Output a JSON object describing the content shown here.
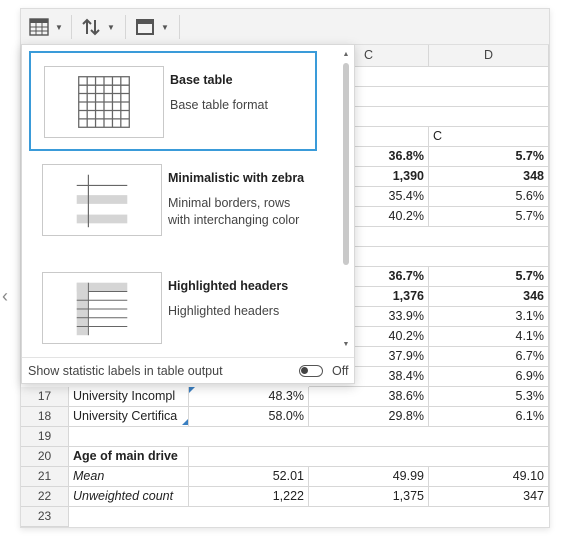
{
  "toolbar": {
    "table_icon": "table-format-icon",
    "sort_icon": "sort-updown-icon",
    "layout_icon": "panel-layout-icon"
  },
  "grid": {
    "col_headers": [
      "C",
      "D"
    ],
    "row1": {
      "num": "",
      "c_sub": "C"
    },
    "rows_upper": [
      {
        "c": "36.8%",
        "d": "5.7%",
        "bold": true
      },
      {
        "c": "1,390",
        "d": "348",
        "bold": true
      },
      {
        "c": "35.4%",
        "d": "5.6%",
        "bold": false
      },
      {
        "c": "40.2%",
        "d": "5.7%",
        "bold": false
      }
    ],
    "rows_mid": [
      {
        "c": "36.7%",
        "d": "5.7%",
        "bold": true
      },
      {
        "c": "1,376",
        "d": "346",
        "bold": true
      },
      {
        "c": "33.9%",
        "d": "3.1%",
        "bold": false
      },
      {
        "c": "40.2%",
        "d": "4.1%",
        "bold": false
      },
      {
        "c": "37.9%",
        "d": "6.7%",
        "bold": false
      },
      {
        "c": "38.4%",
        "d": "6.9%",
        "bold": false
      }
    ],
    "rows_lower": [
      {
        "num": "17",
        "a": "University Incompl",
        "b": "48.3%",
        "c": "38.6%",
        "d": "5.3%"
      },
      {
        "num": "18",
        "a": "University Certifica",
        "b": "58.0%",
        "c": "29.8%",
        "d": "6.1%"
      },
      {
        "num": "19",
        "a": "",
        "b": "",
        "c": "",
        "d": ""
      },
      {
        "num": "20",
        "a": "Age of main drive",
        "b": "",
        "c": "",
        "d": ""
      },
      {
        "num": "21",
        "a": "Mean",
        "b": "52.01",
        "c": "49.99",
        "d": "49.10"
      },
      {
        "num": "22",
        "a": "Unweighted count",
        "b": "1,222",
        "c": "1,375",
        "d": "347"
      },
      {
        "num": "23",
        "a": "",
        "b": "",
        "c": "",
        "d": ""
      }
    ]
  },
  "popup": {
    "options": [
      {
        "title": "Base table",
        "desc": "Base table format"
      },
      {
        "title": "Minimalistic with zebra",
        "desc": "Minimal borders, rows with interchanging color"
      },
      {
        "title": "Highlighted headers",
        "desc": "Highlighted headers"
      }
    ],
    "footer_label": "Show statistic labels in table output",
    "toggle_state": "Off"
  }
}
